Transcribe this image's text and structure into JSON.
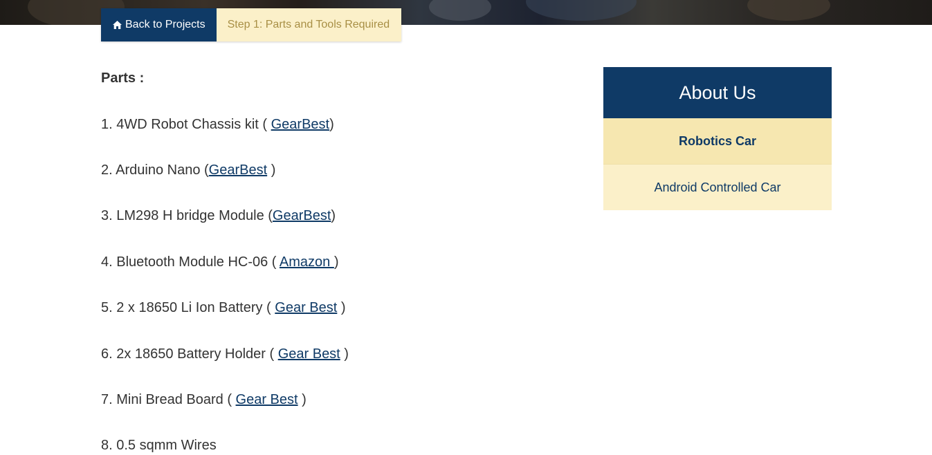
{
  "breadcrumb": {
    "back_label": "Back to Projects",
    "back_icon": "home-icon",
    "current_step": "Step 1: Parts and Tools Required"
  },
  "content": {
    "heading": "Parts :",
    "items": [
      {
        "prefix": "1. 4WD Robot Chassis kit ( ",
        "link": "GearBest",
        "suffix": ")"
      },
      {
        "prefix": "2. Arduino Nano (",
        "link": "GearBest",
        "suffix": " )"
      },
      {
        "prefix": "3. LM298 H bridge Module (",
        "link": "GearBest",
        "suffix": ")"
      },
      {
        "prefix": "4. Bluetooth Module HC-06 ( ",
        "link": "Amazon ",
        "suffix": ")"
      },
      {
        "prefix": "5. 2 x 18650 Li Ion Battery ( ",
        "link": "Gear Best",
        "suffix": " )"
      },
      {
        "prefix": "6. 2x 18650 Battery Holder ( ",
        "link": "Gear Best",
        "suffix": " )"
      },
      {
        "prefix": "7. Mini Bread Board ( ",
        "link": "Gear Best",
        "suffix": " )"
      },
      {
        "prefix": "8. 0.5 sqmm Wires",
        "link": "",
        "suffix": ""
      }
    ]
  },
  "sidebar": {
    "title": "About Us",
    "items": [
      {
        "label": "Robotics Car"
      },
      {
        "label": "Android Controlled Car"
      }
    ]
  },
  "colors": {
    "primary": "#0f3a66",
    "accent_light": "#fbf0c9",
    "accent_active": "#f6e7b0",
    "step_text": "#a88f45"
  }
}
